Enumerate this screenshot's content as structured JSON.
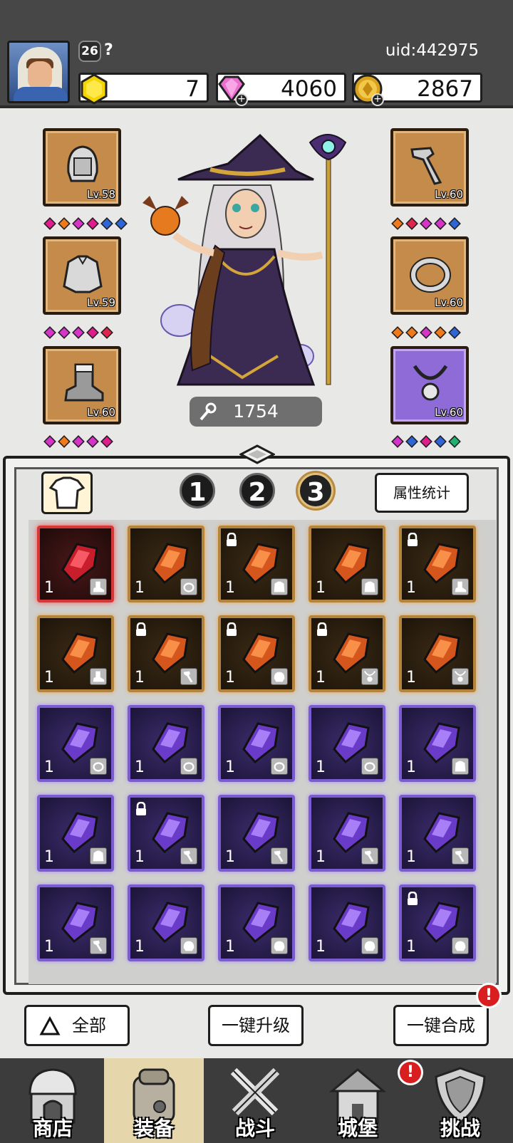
{
  "player": {
    "level": "26",
    "name": "?",
    "uid": "uid:442975"
  },
  "currencies": {
    "gems": "7",
    "diamonds": "4060",
    "coins": "2867"
  },
  "equipment": {
    "left": [
      {
        "slot": "helmet",
        "level": "Lv.58",
        "dots": [
          "pink",
          "orange",
          "magenta",
          "pink",
          "blue",
          "blue"
        ]
      },
      {
        "slot": "armor",
        "level": "Lv.59",
        "dots": [
          "magenta",
          "magenta",
          "magenta",
          "pink",
          "red"
        ]
      },
      {
        "slot": "boots",
        "level": "Lv.60",
        "dots": [
          "magenta",
          "orange",
          "magenta",
          "magenta",
          "pink"
        ]
      }
    ],
    "right": [
      {
        "slot": "weapon",
        "level": "Lv.60",
        "dots": [
          "orange",
          "red",
          "magenta",
          "magenta",
          "blue"
        ]
      },
      {
        "slot": "ring",
        "level": "Lv.60",
        "dots": [
          "orange",
          "orange",
          "magenta",
          "orange",
          "blue"
        ]
      },
      {
        "slot": "necklace",
        "level": "Lv.60",
        "dots": [
          "magenta",
          "blue",
          "pink",
          "blue",
          "green"
        ]
      }
    ]
  },
  "power": "1754",
  "bag": {
    "tabs": [
      "1",
      "2",
      "3"
    ],
    "active_tab": "3",
    "stats_button": "属性统计",
    "items": [
      {
        "rarity": "red",
        "qty": "1",
        "type": "boots-icon",
        "locked": false
      },
      {
        "rarity": "orange",
        "qty": "1",
        "type": "ring-icon",
        "locked": false
      },
      {
        "rarity": "orange",
        "qty": "1",
        "type": "armor-icon",
        "locked": true
      },
      {
        "rarity": "orange",
        "qty": "1",
        "type": "armor-icon",
        "locked": false
      },
      {
        "rarity": "orange",
        "qty": "1",
        "type": "boots-icon",
        "locked": true
      },
      {
        "rarity": "orange",
        "qty": "1",
        "type": "boots-icon",
        "locked": false
      },
      {
        "rarity": "orange",
        "qty": "1",
        "type": "weapon-icon",
        "locked": true
      },
      {
        "rarity": "orange",
        "qty": "1",
        "type": "helmet-icon",
        "locked": true
      },
      {
        "rarity": "orange",
        "qty": "1",
        "type": "necklace-icon",
        "locked": true
      },
      {
        "rarity": "orange",
        "qty": "1",
        "type": "necklace-icon",
        "locked": false
      },
      {
        "rarity": "purple",
        "qty": "1",
        "type": "ring-icon",
        "locked": false
      },
      {
        "rarity": "purple",
        "qty": "1",
        "type": "ring-icon",
        "locked": false
      },
      {
        "rarity": "purple",
        "qty": "1",
        "type": "ring-icon",
        "locked": false
      },
      {
        "rarity": "purple",
        "qty": "1",
        "type": "ring-icon",
        "locked": false
      },
      {
        "rarity": "purple",
        "qty": "1",
        "type": "armor-icon",
        "locked": false
      },
      {
        "rarity": "purple",
        "qty": "1",
        "type": "armor-icon",
        "locked": false
      },
      {
        "rarity": "purple",
        "qty": "1",
        "type": "weapon-icon",
        "locked": true
      },
      {
        "rarity": "purple",
        "qty": "1",
        "type": "weapon-icon",
        "locked": false
      },
      {
        "rarity": "purple",
        "qty": "1",
        "type": "weapon-icon",
        "locked": false
      },
      {
        "rarity": "purple",
        "qty": "1",
        "type": "weapon-icon",
        "locked": false
      },
      {
        "rarity": "purple",
        "qty": "1",
        "type": "weapon-icon",
        "locked": false
      },
      {
        "rarity": "purple",
        "qty": "1",
        "type": "helmet-icon",
        "locked": false
      },
      {
        "rarity": "purple",
        "qty": "1",
        "type": "helmet-icon",
        "locked": false
      },
      {
        "rarity": "purple",
        "qty": "1",
        "type": "helmet-icon",
        "locked": false
      },
      {
        "rarity": "purple",
        "qty": "1",
        "type": "helmet-icon",
        "locked": true
      }
    ]
  },
  "actions": {
    "filter": "全部",
    "upgrade_all": "一键升级",
    "merge_all": "一键合成",
    "alert": "!"
  },
  "nav": [
    {
      "label": "商店",
      "icon": "shop-icon",
      "active": false
    },
    {
      "label": "装备",
      "icon": "backpack-icon",
      "active": true
    },
    {
      "label": "战斗",
      "icon": "swords-icon",
      "active": false
    },
    {
      "label": "城堡",
      "icon": "castle-icon",
      "active": false
    },
    {
      "label": "挑战",
      "icon": "shield-icon",
      "active": false
    }
  ],
  "colors": {
    "orange_rarity": "#b4833c",
    "purple_rarity": "#7a5cd0",
    "red_rarity": "#d63838",
    "topbar": "#474747"
  }
}
